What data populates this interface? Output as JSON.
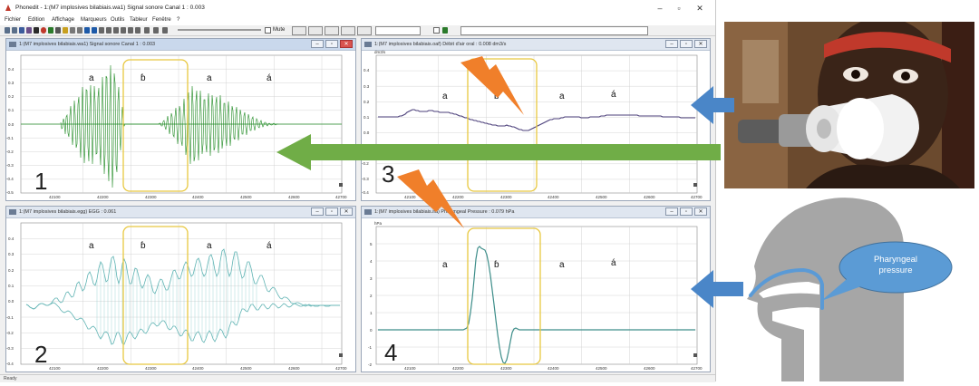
{
  "app": {
    "title": "Phonedit - 1:(M7 implosives bilabiais.wa1) Signal sonore Canal 1 : 0.003",
    "menu": [
      "Fichier",
      "Edition",
      "Affichage",
      "Marqueurs",
      "Outils",
      "Tableur",
      "Fenêtre",
      "?"
    ],
    "mute_label": "Mute",
    "status": "Ready"
  },
  "windows": {
    "w1": {
      "title": "1:(M7 implosives bilabiais.wa1) Signal sonore Canal 1 : 0.003",
      "panel_number": "1"
    },
    "w2": {
      "title": "1:(M7 implosives bilabiais.egg) EGG : 0.061",
      "panel_number": "2"
    },
    "w3": {
      "title": "1:(M7 implosives bilabiais.oaf) Débit d'air oral : 0.008 dm3/s",
      "panel_number": "3",
      "unit": "dm3/s"
    },
    "w4": {
      "title": "1:(M7 implosives bilabiais.ifa) Pharyngeal Pressure : 0.079 hPa",
      "panel_number": "4",
      "unit": "hPa"
    }
  },
  "phones": [
    "a",
    "ɓ",
    "a",
    "á"
  ],
  "x_ticks": [
    "42100",
    "42200",
    "42300",
    "42400",
    "42500",
    "42600",
    "42700"
  ],
  "y_ticks": {
    "w1": [
      "0.4",
      "0.3",
      "0.2",
      "0.1",
      "0.0",
      "-0.1",
      "-0.2",
      "-0.3",
      "-0.4",
      "-0.5"
    ],
    "w2": [
      "0.4",
      "0.3",
      "0.2",
      "0.1",
      "0.0",
      "-0.1",
      "-0.2",
      "-0.3",
      "-0.4"
    ],
    "w3": [
      "0.4",
      "0.3",
      "0.2",
      "0.1",
      "0.0",
      "-0.1",
      "-0.2",
      "-0.3",
      "-0.4"
    ],
    "w4": [
      "5",
      "4",
      "3",
      "2",
      "1",
      "0",
      "-1",
      "-2"
    ]
  },
  "annotation": {
    "label": "Pharyngeal pressure"
  },
  "colors": {
    "audio": "#1e8a22",
    "egg": "#5fb3b3",
    "airflow": "#4b3f7a",
    "pressure": "#3e8e8a",
    "highlight": "#e8c840",
    "arrow_blue": "#4a86c8",
    "arrow_green": "#70ad47",
    "lightning": "#f07f2a",
    "head_gray": "#a6a6a6"
  }
}
